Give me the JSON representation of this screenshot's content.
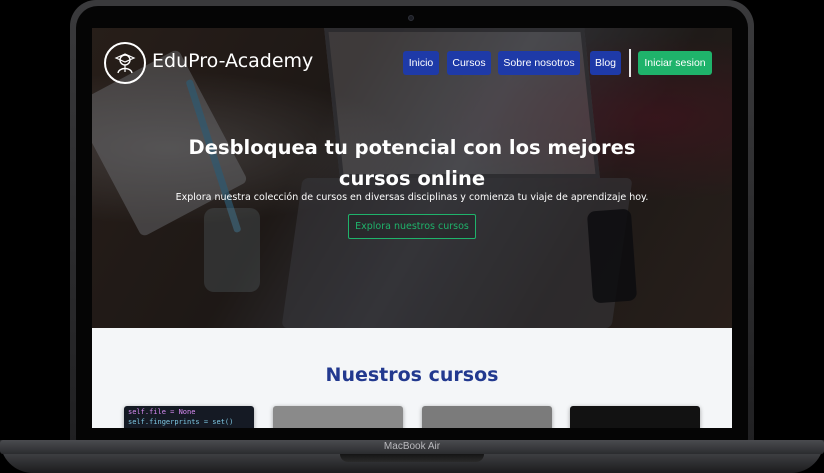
{
  "device": {
    "label": "MacBook Air"
  },
  "nav": {
    "logo_text": "EduPro-Academy",
    "items": [
      {
        "label": "Inicio"
      },
      {
        "label": "Cursos"
      },
      {
        "label": "Sobre nosotros"
      },
      {
        "label": "Blog"
      }
    ],
    "login_label": "Iniciar sesion"
  },
  "hero": {
    "title": "Desbloquea tu potencial con los mejores cursos online",
    "subtitle": "Explora nuestra colección de cursos en diversas disciplinas y comienza tu viaje de aprendizaje hoy.",
    "cta_label": "Explora nuestros cursos"
  },
  "courses": {
    "title": "Nuestros cursos",
    "card1_code": [
      "self.file = None",
      "self.fingerprints = set()"
    ]
  },
  "colors": {
    "primary": "#1e3aa8",
    "accent": "#1fb36b",
    "section_title": "#22398f"
  }
}
